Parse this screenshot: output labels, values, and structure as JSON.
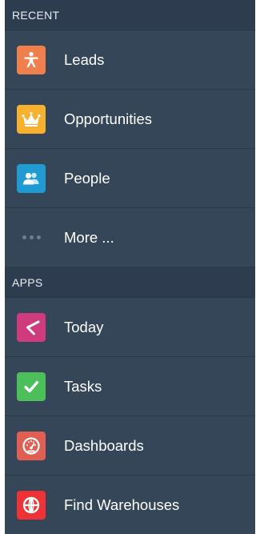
{
  "sections": {
    "recent": {
      "header": "RECENT",
      "items": [
        {
          "label": "Leads",
          "icon": "person-icon",
          "color": "#f07f4e"
        },
        {
          "label": "Opportunities",
          "icon": "crown-icon",
          "color": "#f8b12f"
        },
        {
          "label": "People",
          "icon": "people-icon",
          "color": "#1f9bd1"
        },
        {
          "label": "More ...",
          "icon": "more-dots-icon"
        }
      ]
    },
    "apps": {
      "header": "APPS",
      "items": [
        {
          "label": "Today",
          "icon": "clock-icon",
          "color": "#cf3b7d"
        },
        {
          "label": "Tasks",
          "icon": "checkmark-icon",
          "color": "#4cbf5a"
        },
        {
          "label": "Dashboards",
          "icon": "gauge-icon",
          "color": "#e05f53"
        },
        {
          "label": "Find Warehouses",
          "icon": "globe-icon",
          "color": "#ee3236"
        }
      ]
    }
  }
}
